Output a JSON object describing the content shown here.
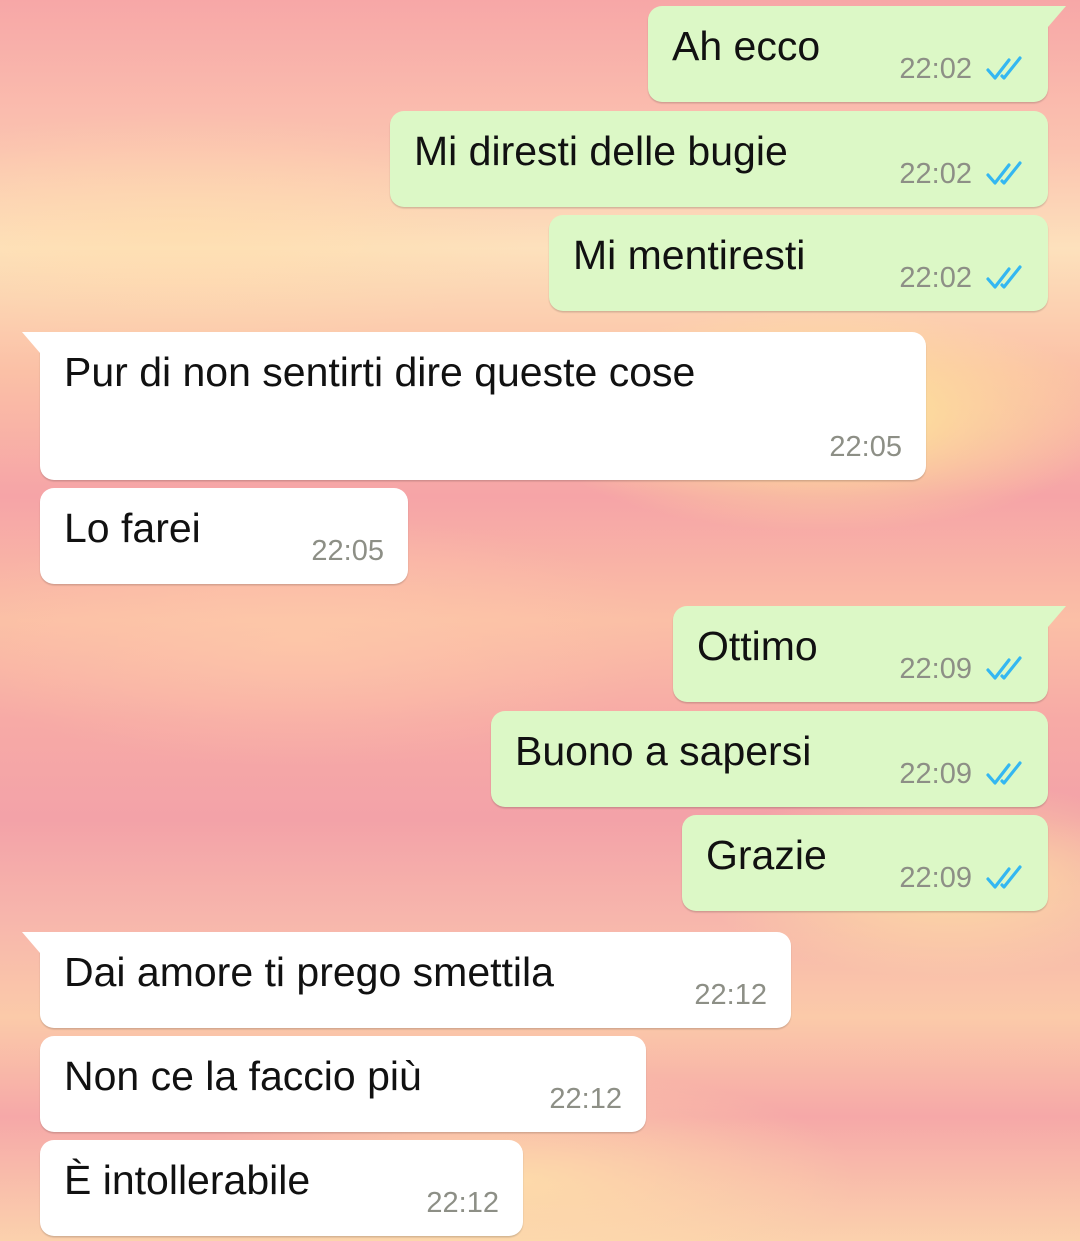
{
  "messages": [
    {
      "dir": "out",
      "text": "Ah ecco",
      "time": "22:02",
      "status": "read"
    },
    {
      "dir": "out",
      "text": "Mi diresti delle bugie",
      "time": "22:02",
      "status": "read"
    },
    {
      "dir": "out",
      "text": "Mi mentiresti",
      "time": "22:02",
      "status": "read"
    },
    {
      "dir": "in",
      "text": "Pur di non sentirti dire queste cose",
      "time": "22:05"
    },
    {
      "dir": "in",
      "text": "Lo farei",
      "time": "22:05"
    },
    {
      "dir": "out",
      "text": "Ottimo",
      "time": "22:09",
      "status": "read"
    },
    {
      "dir": "out",
      "text": "Buono a sapersi",
      "time": "22:09",
      "status": "read"
    },
    {
      "dir": "out",
      "text": "Grazie",
      "time": "22:09",
      "status": "read"
    },
    {
      "dir": "in",
      "text": "Dai amore ti prego smettila",
      "time": "22:12"
    },
    {
      "dir": "in",
      "text": "Non ce la faccio più",
      "time": "22:12"
    },
    {
      "dir": "in",
      "text": "È intollerabile",
      "time": "22:12"
    }
  ],
  "colors": {
    "outgoing_bubble": "#dcf8c6",
    "incoming_bubble": "#ffffff",
    "timestamp": "#8d8f86",
    "read_ticks": "#34b7f1"
  },
  "icons": {
    "read_receipt": "double-check-icon"
  }
}
